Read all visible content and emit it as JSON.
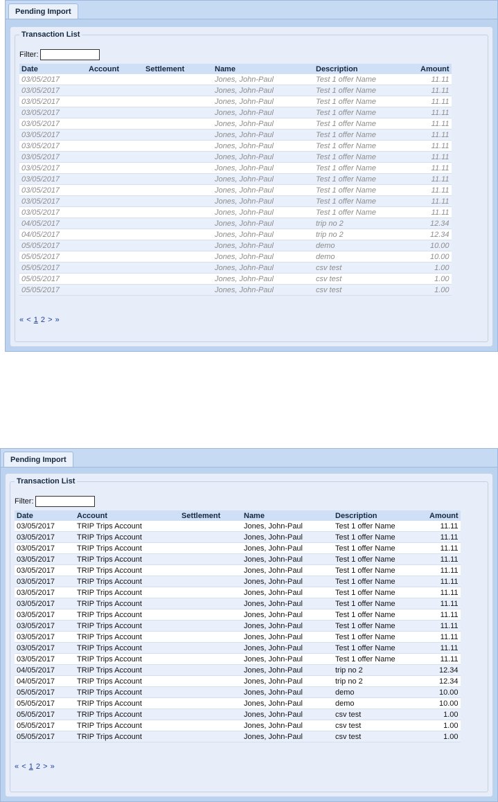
{
  "tab_label": "Pending Import",
  "legend": "Transaction List",
  "filter": {
    "label": "Filter:",
    "value": ""
  },
  "columns": [
    "Date",
    "Account",
    "Settlement",
    "Name",
    "Description",
    "Amount"
  ],
  "pager": {
    "first": "«",
    "prev": "<",
    "page1": "1",
    "page2": "2",
    "next": ">",
    "last": "»"
  },
  "rows_top": [
    [
      "03/05/2017",
      "",
      "",
      "Jones, John-Paul",
      "Test 1 offer Name",
      "11.11"
    ],
    [
      "03/05/2017",
      "",
      "",
      "Jones, John-Paul",
      "Test 1 offer Name",
      "11.11"
    ],
    [
      "03/05/2017",
      "",
      "",
      "Jones, John-Paul",
      "Test 1 offer Name",
      "11.11"
    ],
    [
      "03/05/2017",
      "",
      "",
      "Jones, John-Paul",
      "Test 1 offer Name",
      "11.11"
    ],
    [
      "03/05/2017",
      "",
      "",
      "Jones, John-Paul",
      "Test 1 offer Name",
      "11.11"
    ],
    [
      "03/05/2017",
      "",
      "",
      "Jones, John-Paul",
      "Test 1 offer Name",
      "11.11"
    ],
    [
      "03/05/2017",
      "",
      "",
      "Jones, John-Paul",
      "Test 1 offer Name",
      "11.11"
    ],
    [
      "03/05/2017",
      "",
      "",
      "Jones, John-Paul",
      "Test 1 offer Name",
      "11.11"
    ],
    [
      "03/05/2017",
      "",
      "",
      "Jones, John-Paul",
      "Test 1 offer Name",
      "11.11"
    ],
    [
      "03/05/2017",
      "",
      "",
      "Jones, John-Paul",
      "Test 1 offer Name",
      "11.11"
    ],
    [
      "03/05/2017",
      "",
      "",
      "Jones, John-Paul",
      "Test 1 offer Name",
      "11.11"
    ],
    [
      "03/05/2017",
      "",
      "",
      "Jones, John-Paul",
      "Test 1 offer Name",
      "11.11"
    ],
    [
      "03/05/2017",
      "",
      "",
      "Jones, John-Paul",
      "Test 1 offer Name",
      "11.11"
    ],
    [
      "04/05/2017",
      "",
      "",
      "Jones, John-Paul",
      "trip no 2",
      "12.34"
    ],
    [
      "04/05/2017",
      "",
      "",
      "Jones, John-Paul",
      "trip no 2",
      "12.34"
    ],
    [
      "05/05/2017",
      "",
      "",
      "Jones, John-Paul",
      "demo",
      "10.00"
    ],
    [
      "05/05/2017",
      "",
      "",
      "Jones, John-Paul",
      "demo",
      "10.00"
    ],
    [
      "05/05/2017",
      "",
      "",
      "Jones, John-Paul",
      "csv test",
      "1.00"
    ],
    [
      "05/05/2017",
      "",
      "",
      "Jones, John-Paul",
      "csv test",
      "1.00"
    ],
    [
      "05/05/2017",
      "",
      "",
      "Jones, John-Paul",
      "csv test",
      "1.00"
    ]
  ],
  "rows_bottom": [
    [
      "03/05/2017",
      "TRIP Trips Account",
      "",
      "Jones, John-Paul",
      "Test 1 offer Name",
      "11.11"
    ],
    [
      "03/05/2017",
      "TRIP Trips Account",
      "",
      "Jones, John-Paul",
      "Test 1 offer Name",
      "11.11"
    ],
    [
      "03/05/2017",
      "TRIP Trips Account",
      "",
      "Jones, John-Paul",
      "Test 1 offer Name",
      "11.11"
    ],
    [
      "03/05/2017",
      "TRIP Trips Account",
      "",
      "Jones, John-Paul",
      "Test 1 offer Name",
      "11.11"
    ],
    [
      "03/05/2017",
      "TRIP Trips Account",
      "",
      "Jones, John-Paul",
      "Test 1 offer Name",
      "11.11"
    ],
    [
      "03/05/2017",
      "TRIP Trips Account",
      "",
      "Jones, John-Paul",
      "Test 1 offer Name",
      "11.11"
    ],
    [
      "03/05/2017",
      "TRIP Trips Account",
      "",
      "Jones, John-Paul",
      "Test 1 offer Name",
      "11.11"
    ],
    [
      "03/05/2017",
      "TRIP Trips Account",
      "",
      "Jones, John-Paul",
      "Test 1 offer Name",
      "11.11"
    ],
    [
      "03/05/2017",
      "TRIP Trips Account",
      "",
      "Jones, John-Paul",
      "Test 1 offer Name",
      "11.11"
    ],
    [
      "03/05/2017",
      "TRIP Trips Account",
      "",
      "Jones, John-Paul",
      "Test 1 offer Name",
      "11.11"
    ],
    [
      "03/05/2017",
      "TRIP Trips Account",
      "",
      "Jones, John-Paul",
      "Test 1 offer Name",
      "11.11"
    ],
    [
      "03/05/2017",
      "TRIP Trips Account",
      "",
      "Jones, John-Paul",
      "Test 1 offer Name",
      "11.11"
    ],
    [
      "03/05/2017",
      "TRIP Trips Account",
      "",
      "Jones, John-Paul",
      "Test 1 offer Name",
      "11.11"
    ],
    [
      "04/05/2017",
      "TRIP Trips Account",
      "",
      "Jones, John-Paul",
      "trip no 2",
      "12.34"
    ],
    [
      "04/05/2017",
      "TRIP Trips Account",
      "",
      "Jones, John-Paul",
      "trip no 2",
      "12.34"
    ],
    [
      "05/05/2017",
      "TRIP Trips Account",
      "",
      "Jones, John-Paul",
      "demo",
      "10.00"
    ],
    [
      "05/05/2017",
      "TRIP Trips Account",
      "",
      "Jones, John-Paul",
      "demo",
      "10.00"
    ],
    [
      "05/05/2017",
      "TRIP Trips Account",
      "",
      "Jones, John-Paul",
      "csv test",
      "1.00"
    ],
    [
      "05/05/2017",
      "TRIP Trips Account",
      "",
      "Jones, John-Paul",
      "csv test",
      "1.00"
    ],
    [
      "05/05/2017",
      "TRIP Trips Account",
      "",
      "Jones, John-Paul",
      "csv test",
      "1.00"
    ]
  ]
}
